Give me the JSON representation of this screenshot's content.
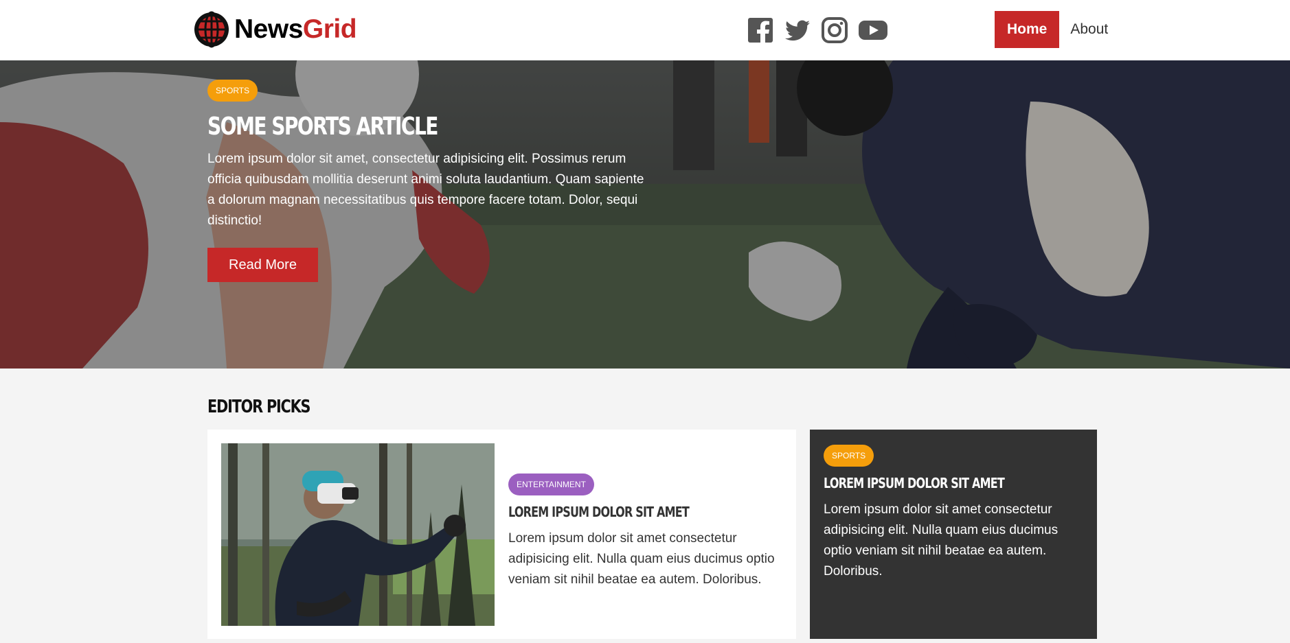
{
  "brand": {
    "name_part1": "News",
    "name_part2": "Grid",
    "accent_color": "#c62828"
  },
  "social": [
    {
      "name": "facebook-icon"
    },
    {
      "name": "twitter-icon"
    },
    {
      "name": "instagram-icon"
    },
    {
      "name": "youtube-icon"
    }
  ],
  "nav": {
    "home": "Home",
    "about": "About"
  },
  "hero": {
    "category": "Sports",
    "title": "Some Sports Article",
    "text": "Lorem ipsum dolor sit amet, consectetur adipisicing elit. Possimus rerum officia quibusdam mollitia deserunt animi soluta laudantium. Quam sapiente a dolorum magnam necessitatibus quis tempore facere totam. Dolor, sequi distinctio!",
    "button": "Read More"
  },
  "editor_picks": {
    "heading": "Editor Picks",
    "main_card": {
      "category": "Entertainment",
      "title": "Lorem ipsum dolor sit amet",
      "text": "Lorem ipsum dolor sit amet consectetur adipisicing elit. Nulla quam eius ducimus optio veniam sit nihil beatae ea autem. Doloribus."
    },
    "side_card": {
      "category": "Sports",
      "title": "Lorem ipsum dolor sit amet",
      "text": "Lorem ipsum dolor sit amet consectetur adipisicing elit. Nulla quam eius ducimus optio veniam sit nihil beatae ea autem. Doloribus."
    }
  },
  "colors": {
    "sports": "#f59e0b",
    "entertainment": "#9b5fc0",
    "dark_card": "#333333",
    "bg": "#f4f4f4"
  }
}
